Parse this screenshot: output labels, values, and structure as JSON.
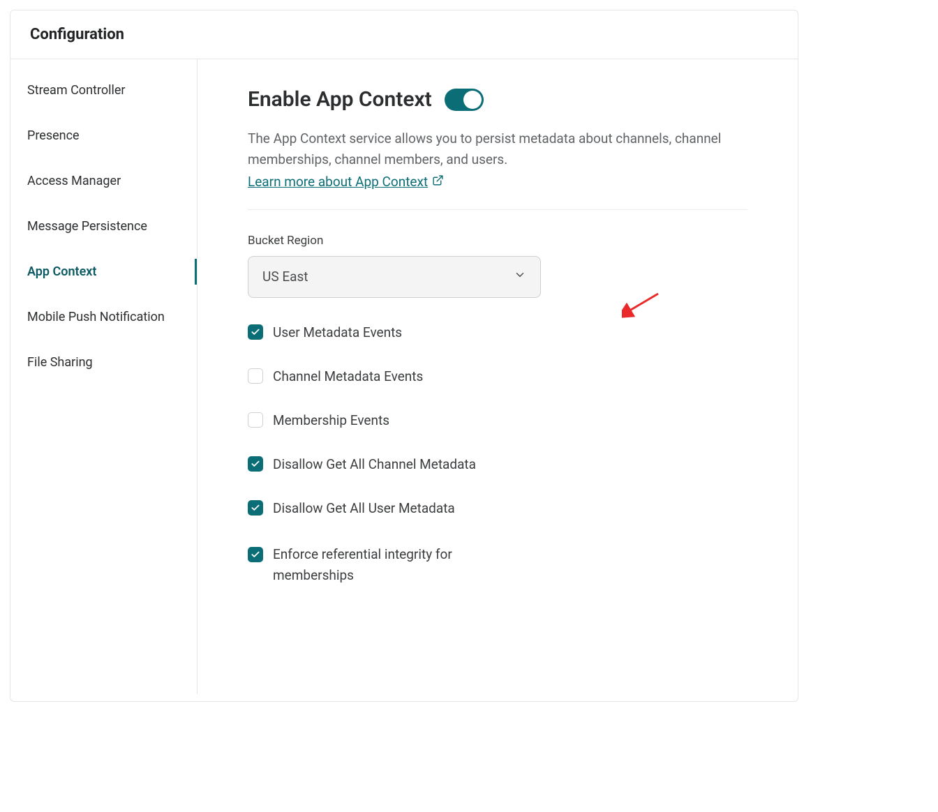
{
  "header": {
    "title": "Configuration"
  },
  "sidebar": {
    "items": [
      {
        "label": "Stream Controller",
        "active": false
      },
      {
        "label": "Presence",
        "active": false
      },
      {
        "label": "Access Manager",
        "active": false
      },
      {
        "label": "Message Persistence",
        "active": false
      },
      {
        "label": "App Context",
        "active": true
      },
      {
        "label": "Mobile Push Notification",
        "active": false
      },
      {
        "label": "File Sharing",
        "active": false
      }
    ]
  },
  "main": {
    "title": "Enable App Context",
    "toggle_on": true,
    "description": "The App Context service allows you to persist metadata about channels, channel memberships, channel members, and users.",
    "learn_more_label": "Learn more about App Context",
    "bucket_region": {
      "label": "Bucket Region",
      "value": "US East"
    },
    "options": [
      {
        "label": "User Metadata Events",
        "checked": true
      },
      {
        "label": "Channel Metadata Events",
        "checked": false
      },
      {
        "label": "Membership Events",
        "checked": false
      },
      {
        "label": "Disallow Get All Channel Metadata",
        "checked": true
      },
      {
        "label": "Disallow Get All User Metadata",
        "checked": true
      },
      {
        "label": "Enforce referential integrity for memberships",
        "checked": true
      }
    ]
  },
  "colors": {
    "accent": "#0b6e77",
    "text": "#2b2d2f",
    "muted": "#606366",
    "annotation": "#ea2a2a"
  }
}
